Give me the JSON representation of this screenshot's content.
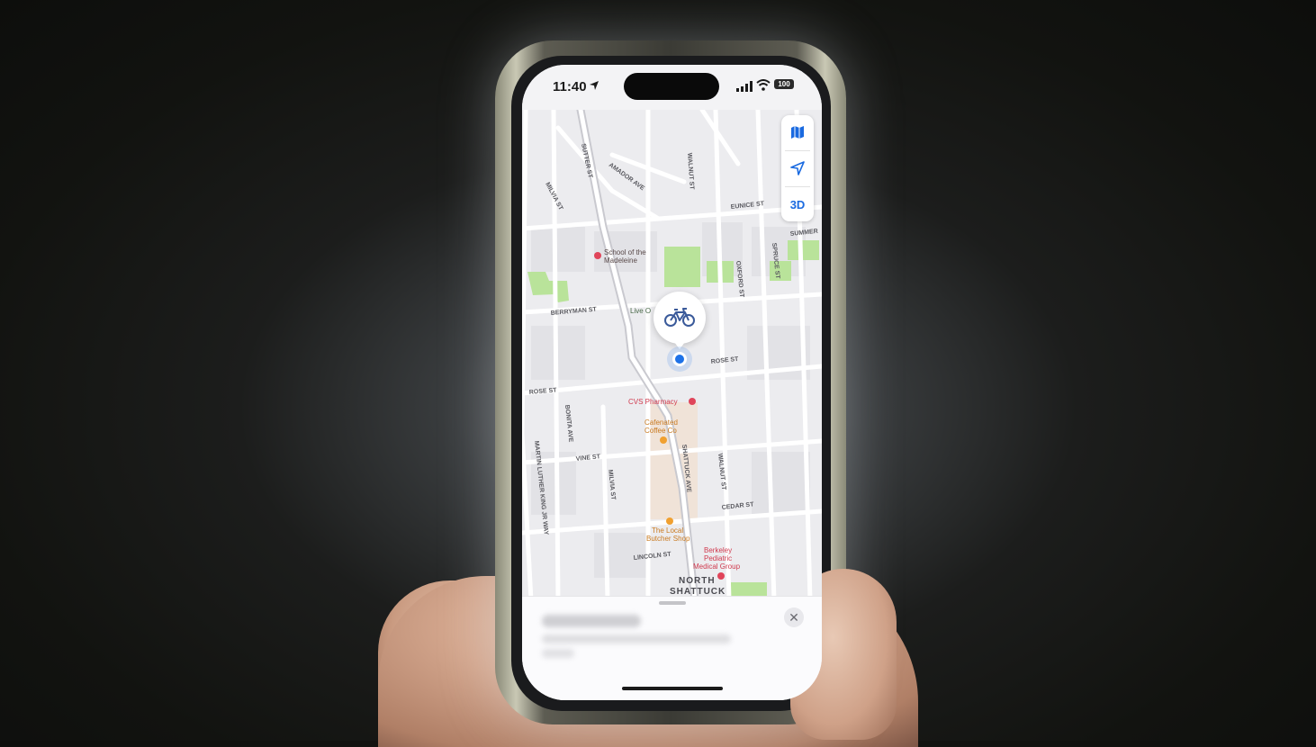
{
  "status_bar": {
    "time": "11:40",
    "battery": "100"
  },
  "map_controls": {
    "map_icon": "map-icon",
    "location_icon": "location-arrow-icon",
    "three_d_label": "3D"
  },
  "streets": {
    "sutter": "SUTTER ST",
    "amador": "AMADOR AVE",
    "milvia_top": "MILVIA ST",
    "walnut_top": "WALNUT ST",
    "eunice": "EUNICE ST",
    "summer": "SUMMER",
    "spruce": "SPRUCE ST",
    "oxford": "OXFORD ST",
    "berryman": "BERRYMAN ST",
    "rose_right": "ROSE ST",
    "rose_left": "ROSE ST",
    "bonita": "BONITA AVE",
    "vine": "VINE ST",
    "milvia_bottom": "MILVIA ST",
    "shattuck": "SHATTUCK AVE",
    "walnut_bottom": "WALNUT ST",
    "cedar": "CEDAR ST",
    "mlk": "MARTIN LUTHER KING JR WAY",
    "lincoln": "LINCOLN ST"
  },
  "places": {
    "school_line1": "School of the",
    "school_line2": "Madeleine",
    "live_oak": "Live O",
    "cvs": "CVS Pharmacy",
    "cafe_line1": "Cafenated",
    "cafe_line2": "Coffee Co",
    "butcher_line1": "The Local",
    "butcher_line2": "Butcher Shop",
    "berkeley_line1": "Berkeley",
    "berkeley_line2": "Pediatric",
    "berkeley_line3": "Medical Group",
    "neighborhood_line1": "NORTH",
    "neighborhood_line2": "SHATTUCK"
  },
  "pin": {
    "icon": "bicycle-icon"
  },
  "sheet": {
    "close_icon": "close-icon",
    "close_glyph": "✕"
  },
  "colors": {
    "accent": "#1a6ae0",
    "park": "#b9e39a",
    "poi_red": "#e0455a",
    "poi_orange": "#f0a030"
  }
}
